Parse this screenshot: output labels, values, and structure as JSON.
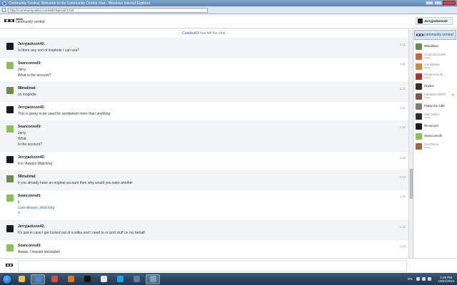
{
  "window": {
    "title": "Community Central: Welcome to the Community Central chat - Windows Internet Explorer",
    "url": "http://community.wikia.com/wiki/Special:Chat"
  },
  "header": {
    "wiki_name": "community central",
    "wiki_brand": "wikia",
    "current_user": "Jerryjackson42"
  },
  "alert": {
    "user": "Catalisa53",
    "text": "has left the chat."
  },
  "messages": [
    {
      "user": "Jerryjackson42:",
      "time": "1:11",
      "lines": [
        "Is there any sort of loophole I can use?"
      ],
      "avatar_color": "#1a1a1a"
    },
    {
      "user": "Seanconnolli:",
      "time": "1:11",
      "lines": [
        "Jerry",
        "What is the account?"
      ],
      "avatar_color": "#8bbf5a"
    },
    {
      "user": "98mailmal:",
      "time": "1:11",
      "lines": [
        "no loophole"
      ],
      "avatar_color": "#6f8a4a"
    },
    {
      "user": "Jerryjackson42:",
      "time": "1:11",
      "lines": [
        "This is going to be used for symbolism more than anything"
      ],
      "avatar_color": "#1a1a1a"
    },
    {
      "user": "Seanconnolli:",
      "time": "1:12",
      "lines": [
        "Jerry,",
        "What.",
        "Is the account?"
      ],
      "avatar_color": "#8bbf5a"
    },
    {
      "user": "Jerryjackson42:",
      "time": "1:12",
      "lines": [
        "It is 'Always Watching'"
      ],
      "avatar_color": "#1a1a1a"
    },
    {
      "user": "98mailmal:",
      "time": "1:12",
      "lines": [
        "if you already have an original account then why would you want another"
      ],
      "avatar_color": "#6f8a4a"
    },
    {
      "user": "Seanconnolli:",
      "time": "1:12",
      "lines": [
        "k",
        "User:Always_Watching",
        "?"
      ],
      "link_index": 1,
      "avatar_color": "#8bbf5a"
    },
    {
      "user": "Jerryjackson42:",
      "time": "1:12",
      "lines": [
        "It's just in case I get locked out of a wikia and I need to re`port stuff on my behalf."
      ],
      "avatar_color": "#1a1a1a"
    },
    {
      "user": "Seanconnolli:",
      "time": "1:13",
      "lines": [
        "Awww, I missed elecbullet!"
      ],
      "avatar_color": "#8bbf5a"
    }
  ],
  "sidebar": {
    "room_name": "community central",
    "users": [
      {
        "name": "98mailmal",
        "status": "",
        "color": "#6f8a4a",
        "away": false,
        "star": false
      },
      {
        "name": "CoolCat123459",
        "status": "Away",
        "color": "#c46a3a",
        "away": true,
        "star": false
      },
      {
        "name": "Cat Bukake",
        "status": "Away",
        "color": "#d08a30",
        "away": true,
        "star": false
      },
      {
        "name": "Dangerous Bl...",
        "status": "Away",
        "color": "#b0332b",
        "away": true,
        "star": false
      },
      {
        "name": "Drydon",
        "status": "",
        "color": "#3c2a22",
        "away": false,
        "star": false
      },
      {
        "name": "Katalisa449878",
        "status": "Away",
        "color": "#7a5a48",
        "away": true,
        "star": true
      },
      {
        "name": "Friday the 13th",
        "status": "",
        "color": "#8a7c6a",
        "away": false,
        "star": false
      },
      {
        "name": "Mad Hatter",
        "status": "Away",
        "color": "#2c2c2c",
        "away": true,
        "star": false
      },
      {
        "name": "Mr Secord",
        "status": "",
        "color": "#1a1a1a",
        "away": false,
        "star": false
      },
      {
        "name": "Seanconnolli",
        "status": "",
        "color": "#8bbf5a",
        "away": false,
        "star": false
      },
      {
        "name": "SoulTamer",
        "status": "Away",
        "color": "#9a6a3a",
        "away": true,
        "star": false
      }
    ]
  },
  "input": {
    "placeholder": ""
  },
  "taskbar": {
    "apps": [
      {
        "name": "explorer",
        "color": "#f0c040",
        "active": false
      },
      {
        "name": "internet-explorer",
        "color": "#3b8ad8",
        "active": true
      },
      {
        "name": "chrome",
        "color": "#d94b3b",
        "active": false
      },
      {
        "name": "media-player",
        "color": "#e07a20",
        "active": false
      },
      {
        "name": "command-prompt",
        "color": "#111111",
        "active": false
      },
      {
        "name": "notepad",
        "color": "#e6e6e6",
        "active": false
      },
      {
        "name": "skype",
        "color": "#19a6e8",
        "active": false
      },
      {
        "name": "calculator",
        "color": "#5d7ea3",
        "active": false
      },
      {
        "name": "windows-media",
        "color": "#7aa3c9",
        "active": true
      }
    ],
    "lang": "EN",
    "time": "1:26 PM",
    "date": "10/01/2013"
  }
}
